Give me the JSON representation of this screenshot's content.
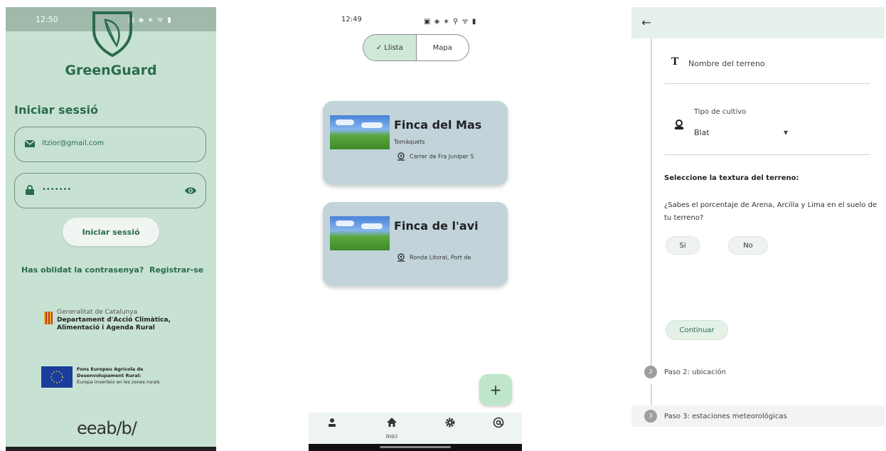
{
  "colors": {
    "login_bg": "#c7e2d3",
    "brand_green": "#2a6b4b",
    "card_bg": "#c2d4da",
    "segment_selected": "#cfe9d8",
    "fab": "#bfe6cc",
    "form_header": "#e6f0ea"
  },
  "login": {
    "status_time": "12:50",
    "app_name": "GreenGuard",
    "title": "Iniciar sessió",
    "email_value": "itzior@gmail.com",
    "password_value": "•••••••",
    "login_button": "Iniciar sessió",
    "forgot_link": "Has oblidat la contrasenya?",
    "register_link": "Registrar-se",
    "gencat": {
      "line1": "Generalitat de Catalunya",
      "line2": "Departament d'Acció Climàtica,",
      "line3": "Alimentació i Agenda Rural"
    },
    "feader": {
      "line1": "Fons Europeu Agrícola de",
      "line2": "Desenvolupament Rural:",
      "line3": "Europa inverteix en les zones rurals"
    },
    "partner_logo": "eeab/b/"
  },
  "list": {
    "status_time": "12:49",
    "segments": [
      {
        "label": "Llista",
        "selected": true
      },
      {
        "label": "Mapa",
        "selected": false
      }
    ],
    "cards": [
      {
        "name": "Finca del Mas",
        "subtitle": "Tomàquets",
        "address": "Carrer de Fra Juniper S"
      },
      {
        "name": "Finca de l'avi",
        "subtitle": "",
        "address": "Ronda Litoral, Port de"
      }
    ],
    "fab_label": "+",
    "nav": {
      "home_label": "Inici",
      "items": [
        "profile-icon",
        "home-icon",
        "gear-icon",
        "at-icon"
      ]
    }
  },
  "form": {
    "back_icon": "arrow-left-icon",
    "name_placeholder": "Nombre del terreno",
    "crop_label": "Tipo de cultivo",
    "crop_value": "Blat",
    "texture_heading": "Seleccione la textura del terreno:",
    "texture_question": "¿Sabes el porcentaje de Arena, Arcilla y Lima en el suelo de tu terreno?",
    "yes_label": "Si",
    "no_label": "No",
    "continue_label": "Continuar",
    "steps": [
      {
        "number": "2",
        "label": "Paso 2: ubicación"
      },
      {
        "number": "3",
        "label": "Paso 3: estaciones meteorológicas"
      }
    ]
  }
}
